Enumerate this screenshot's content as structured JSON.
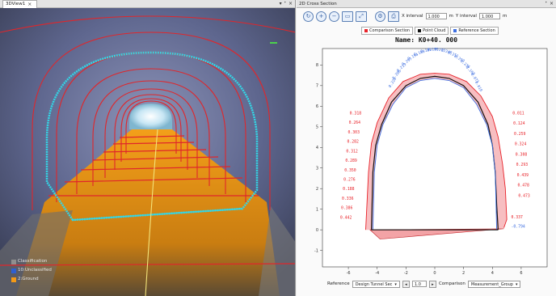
{
  "left_panel": {
    "tab_title": "3DView1",
    "tab_close": "×",
    "window_controls": [
      "▾",
      "ᐩ",
      "×"
    ],
    "legend": [
      {
        "label": "Classification",
        "color": "#8f8f8f"
      },
      {
        "label": "10:Unclassified",
        "color": "#2e5fd1"
      },
      {
        "label": "2:Ground",
        "color": "#f49a16"
      }
    ]
  },
  "right_panel": {
    "tab_title": "2D Cross Section",
    "window_controls": [
      "ᐩ",
      "×"
    ],
    "toolbar": {
      "x_interval_label": "X interval",
      "x_interval_value": "1.000",
      "y_interval_label": "Y interval",
      "y_interval_value": "1.000",
      "unit": "m"
    },
    "legend": [
      {
        "label": "Comparison Section",
        "color": "#e8232a"
      },
      {
        "label": "Point Cloud",
        "color": "#111111"
      },
      {
        "label": "Reference Section",
        "color": "#3f6fe0"
      }
    ],
    "section_name": "Name: K0+40. 000",
    "bottom": {
      "reference_label": "Reference",
      "reference_value": "Design Tunnel Sec",
      "prev_btn": "◂",
      "step_value": "1.0",
      "next_btn": "▸",
      "comparison_label": "Comparison",
      "comparison_value": "Measurement_Group"
    }
  },
  "chart_data": {
    "type": "line",
    "title": "Name: K0+40. 000",
    "x_ticks": [
      -6,
      -4,
      -2,
      0,
      2,
      4,
      6
    ],
    "y_ticks": [
      -1,
      0,
      1,
      2,
      3,
      4,
      5,
      6,
      7,
      8
    ],
    "xlim": [
      -7.8,
      7.8
    ],
    "ylim": [
      -1.8,
      8.8
    ],
    "grid": false,
    "series": [
      {
        "name": "Comparison Section",
        "color": "#e8232a",
        "x": [
          -4.8,
          -4.6,
          -4.4,
          -4.0,
          -3.2,
          -2.2,
          -1.0,
          0.0,
          1.0,
          2.2,
          3.2,
          4.0,
          4.4,
          4.7,
          4.9,
          5.0,
          4.8
        ],
        "y": [
          0.0,
          2.8,
          4.2,
          5.2,
          6.4,
          7.2,
          7.55,
          7.6,
          7.55,
          7.2,
          6.5,
          5.5,
          4.5,
          3.2,
          2.0,
          0.5,
          0.1
        ]
      },
      {
        "name": "Point Cloud",
        "color": "#111111",
        "x": [
          -4.4,
          -4.3,
          -4.1,
          -3.7,
          -3.0,
          -2.0,
          -1.0,
          0.0,
          1.0,
          2.0,
          3.0,
          3.7,
          4.0,
          4.2,
          4.3,
          4.4
        ],
        "y": [
          0.0,
          2.8,
          4.1,
          5.1,
          6.2,
          7.0,
          7.35,
          7.45,
          7.35,
          7.0,
          6.2,
          5.1,
          4.1,
          2.8,
          1.2,
          0.0
        ]
      },
      {
        "name": "Reference Section",
        "color": "#3f6fe0",
        "x": [
          -4.3,
          -4.2,
          -4.0,
          -3.6,
          -2.9,
          -2.0,
          -1.0,
          0.0,
          1.0,
          2.0,
          2.9,
          3.6,
          4.0,
          4.2,
          4.3
        ],
        "y": [
          0.0,
          2.8,
          4.1,
          5.1,
          6.1,
          6.9,
          7.25,
          7.35,
          7.25,
          6.9,
          6.1,
          5.1,
          4.1,
          2.8,
          0.0
        ]
      }
    ],
    "top_annotations": [
      "0.226",
      "0.206",
      "0.213",
      "0.297",
      "0.194",
      "0.189",
      "0.188",
      "0.199",
      "0.213",
      "0.246",
      "0.251",
      "0.293",
      "0.236",
      "0.168",
      "0.071",
      "0.019"
    ],
    "left_annotations": [
      "0.318",
      "0.264",
      "0.303",
      "0.282",
      "0.312",
      "0.289",
      "0.350",
      "0.276",
      "0.188",
      "0.336",
      "0.386",
      "0.442"
    ],
    "right_annotations": [
      "0.011",
      "0.124",
      "0.259",
      "0.324",
      "0.308",
      "0.293",
      "0.439",
      "0.478",
      "0.473"
    ],
    "bottom_right_annotations": [
      "0.337",
      "-0.794"
    ]
  }
}
